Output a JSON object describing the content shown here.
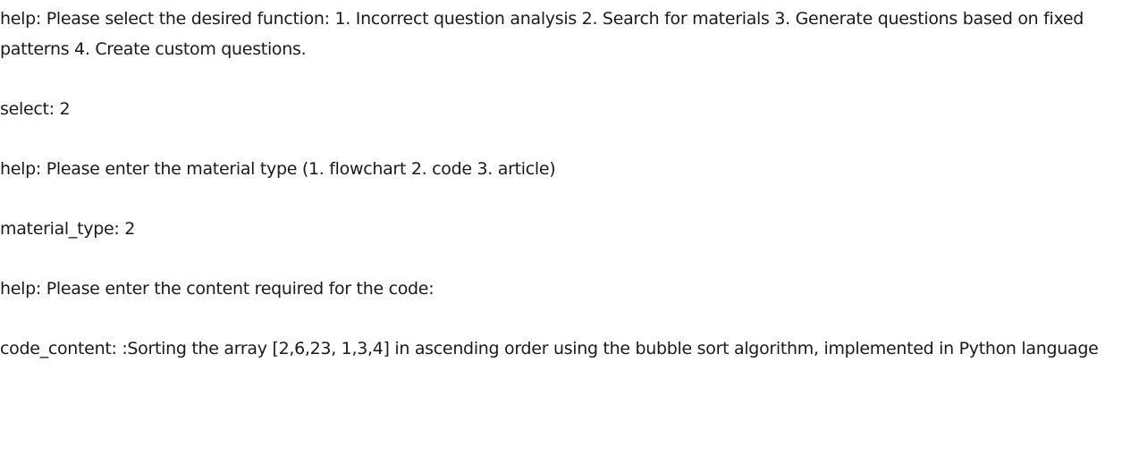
{
  "conversation": [
    {
      "key": "help",
      "text": "Please select the desired function: 1. Incorrect question analysis 2. Search for materials 3. Generate questions based on fixed patterns 4. Create custom questions."
    },
    {
      "key": "select",
      "text": "2"
    },
    {
      "key": "help",
      "text": "Please enter the material type (1. flowchart 2. code 3. article)"
    },
    {
      "key": "material_type",
      "text": "2"
    },
    {
      "key": "help",
      "text": "Please enter the content required for the code:"
    },
    {
      "key": "code_content",
      "text": ":Sorting the array [2,6,23, 1,3,4] in ascending order using the bubble sort algorithm, implemented in Python language"
    }
  ],
  "separator": ": "
}
